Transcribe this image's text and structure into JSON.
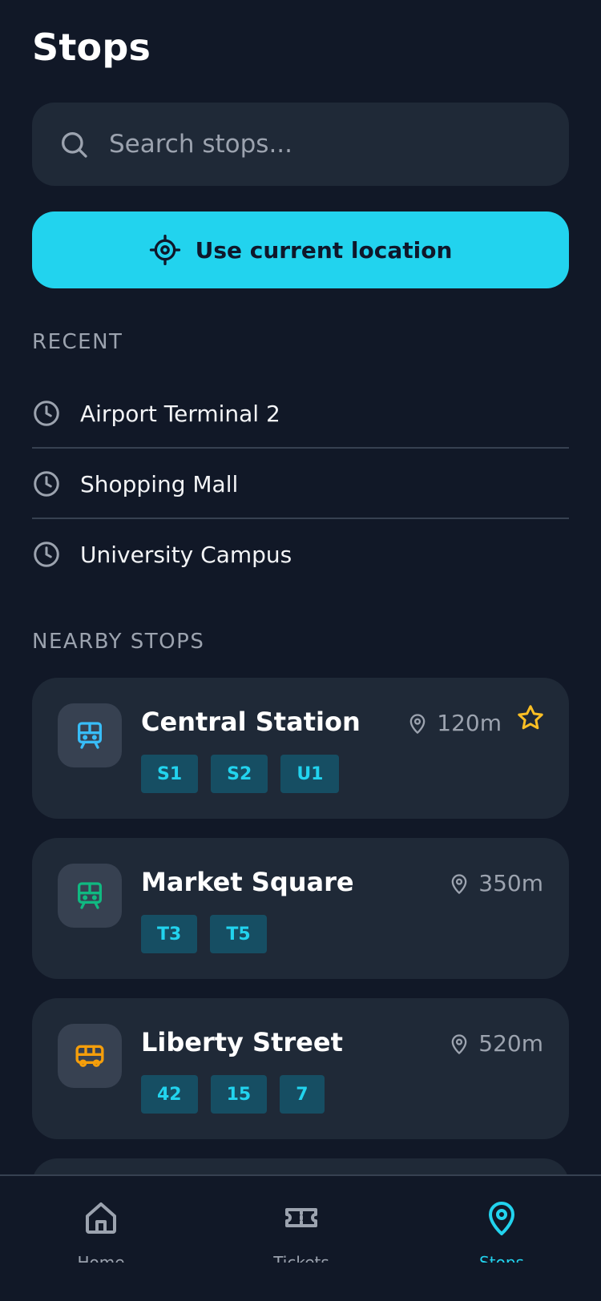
{
  "header": {
    "title": "Stops"
  },
  "search": {
    "placeholder": "Search stops..."
  },
  "location_button": {
    "label": "Use current location"
  },
  "recent": {
    "section_label": "RECENT",
    "items": [
      {
        "label": "Airport Terminal 2"
      },
      {
        "label": "Shopping Mall"
      },
      {
        "label": "University Campus"
      }
    ]
  },
  "nearby": {
    "section_label": "NEARBY STOPS",
    "stops": [
      {
        "name": "Central Station",
        "distance": "120m",
        "type": "train",
        "favorite": true,
        "icon_color": "#38bdf8",
        "lines": [
          "S1",
          "S2",
          "U1"
        ]
      },
      {
        "name": "Market Square",
        "distance": "350m",
        "type": "tram",
        "favorite": false,
        "icon_color": "#10b981",
        "lines": [
          "T3",
          "T5"
        ]
      },
      {
        "name": "Liberty Street",
        "distance": "520m",
        "type": "bus",
        "favorite": false,
        "icon_color": "#f59e0b",
        "lines": [
          "42",
          "15",
          "7"
        ]
      }
    ]
  },
  "bottom_nav": {
    "items": [
      {
        "label": "Home",
        "icon": "home-icon",
        "active": false
      },
      {
        "label": "Tickets",
        "icon": "ticket-icon",
        "active": false
      },
      {
        "label": "Stops",
        "icon": "map-pin-icon",
        "active": true
      }
    ]
  },
  "colors": {
    "background": "#111827",
    "surface": "#1f2937",
    "accent": "#22d3ee",
    "favorite": "#fbbf24",
    "muted_text": "#9ca3af"
  }
}
